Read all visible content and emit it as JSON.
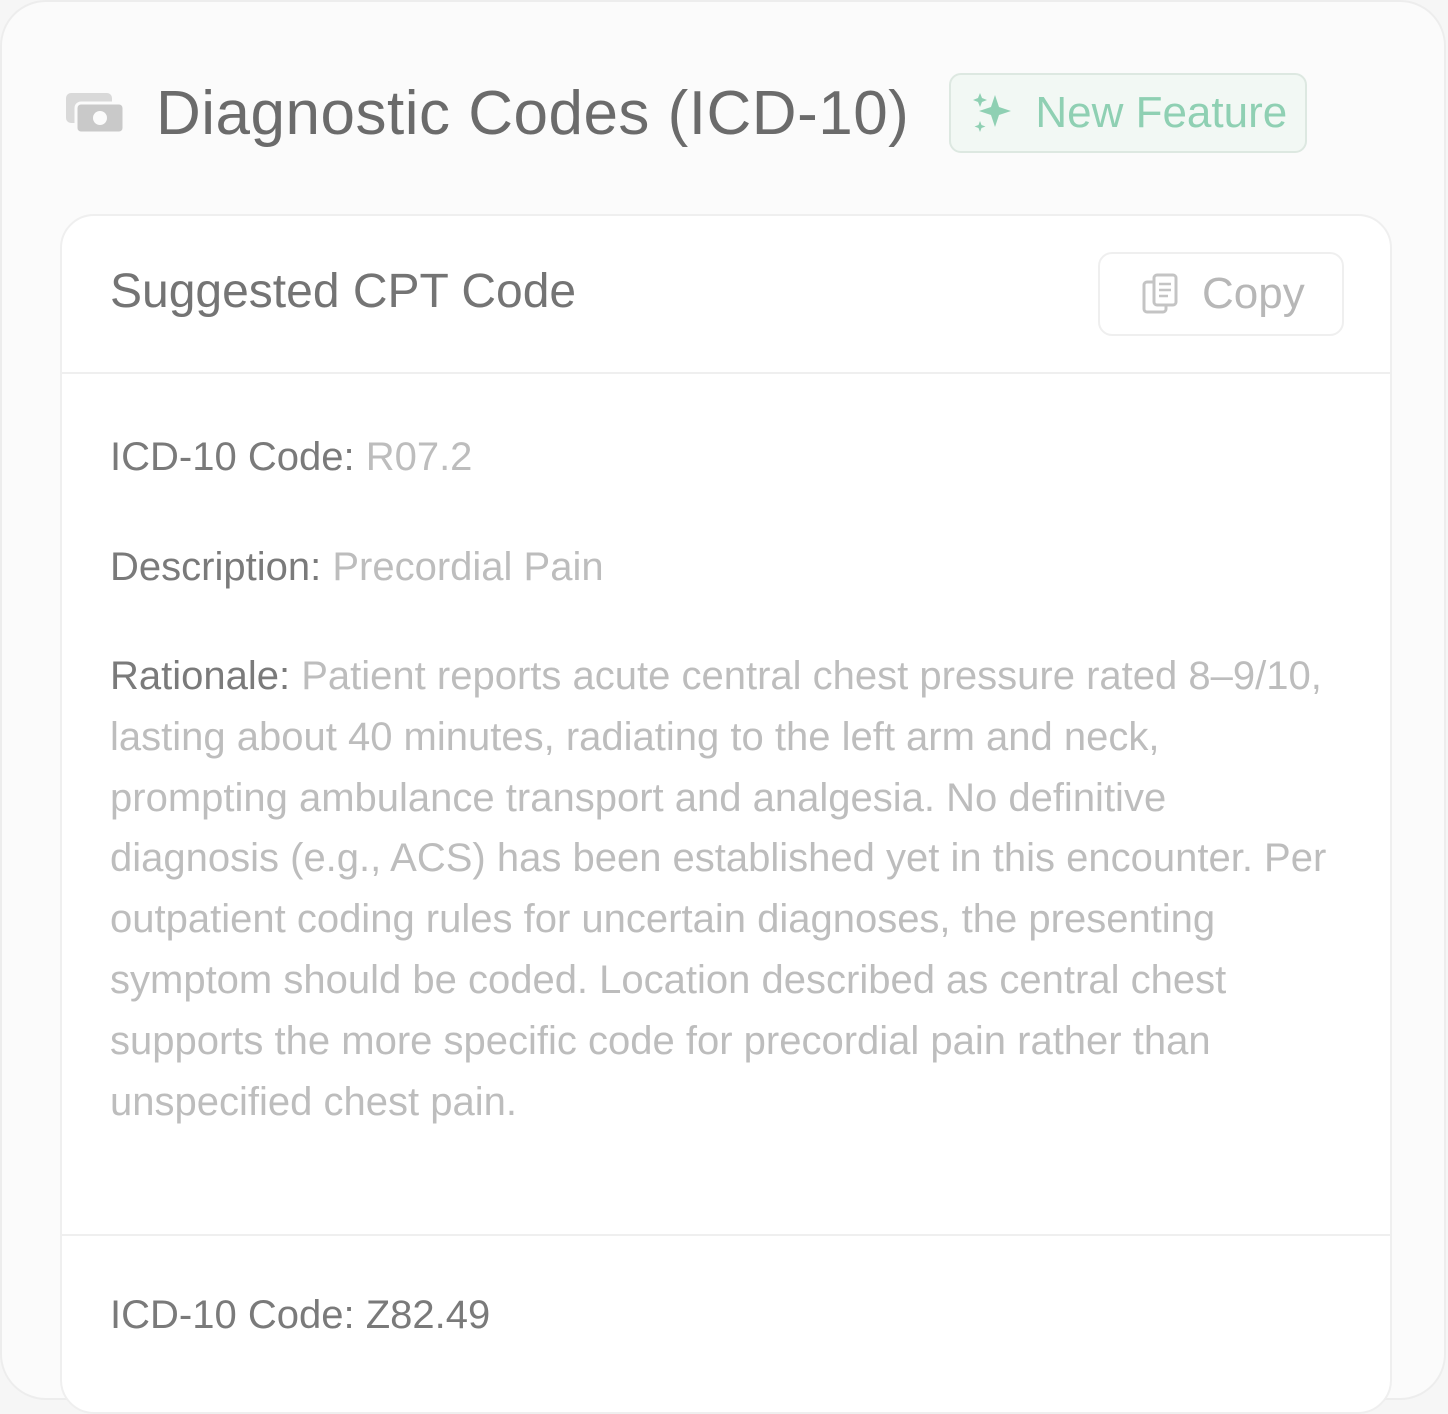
{
  "header": {
    "title": "Diagnostic Codes (ICD-10)",
    "badge_label": "New Feature",
    "icon": "money-icon",
    "badge_icon": "sparkles-icon"
  },
  "card": {
    "title": "Suggested CPT Code",
    "copy_label": "Copy",
    "copy_icon": "clipboard-icon"
  },
  "codes": [
    {
      "code_label": "ICD-10 Code:",
      "code_value": "R07.2",
      "description_label": "Description:",
      "description_value": "Precordial Pain",
      "rationale_label": "Rationale:",
      "rationale_value": "Patient reports acute central chest pressure rated 8–9/10, lasting about 40 minutes, radiating to the left arm and neck, prompting ambulance transport and analgesia. No definitive diagnosis (e.g., ACS) has been established yet in this encounter. Per outpatient coding rules for uncertain diagnoses, the presenting symptom should be coded. Location described as central chest supports the more specific code for precordial pain rather than unspecified chest pain."
    },
    {
      "code_label": "ICD-10 Code:",
      "code_value": "Z82.49"
    }
  ],
  "colors": {
    "accent_green": "#8fd0b3",
    "badge_bg": "#f2f8f4",
    "title_gray": "#6b6b6b",
    "muted_text": "#bdbdbd"
  }
}
